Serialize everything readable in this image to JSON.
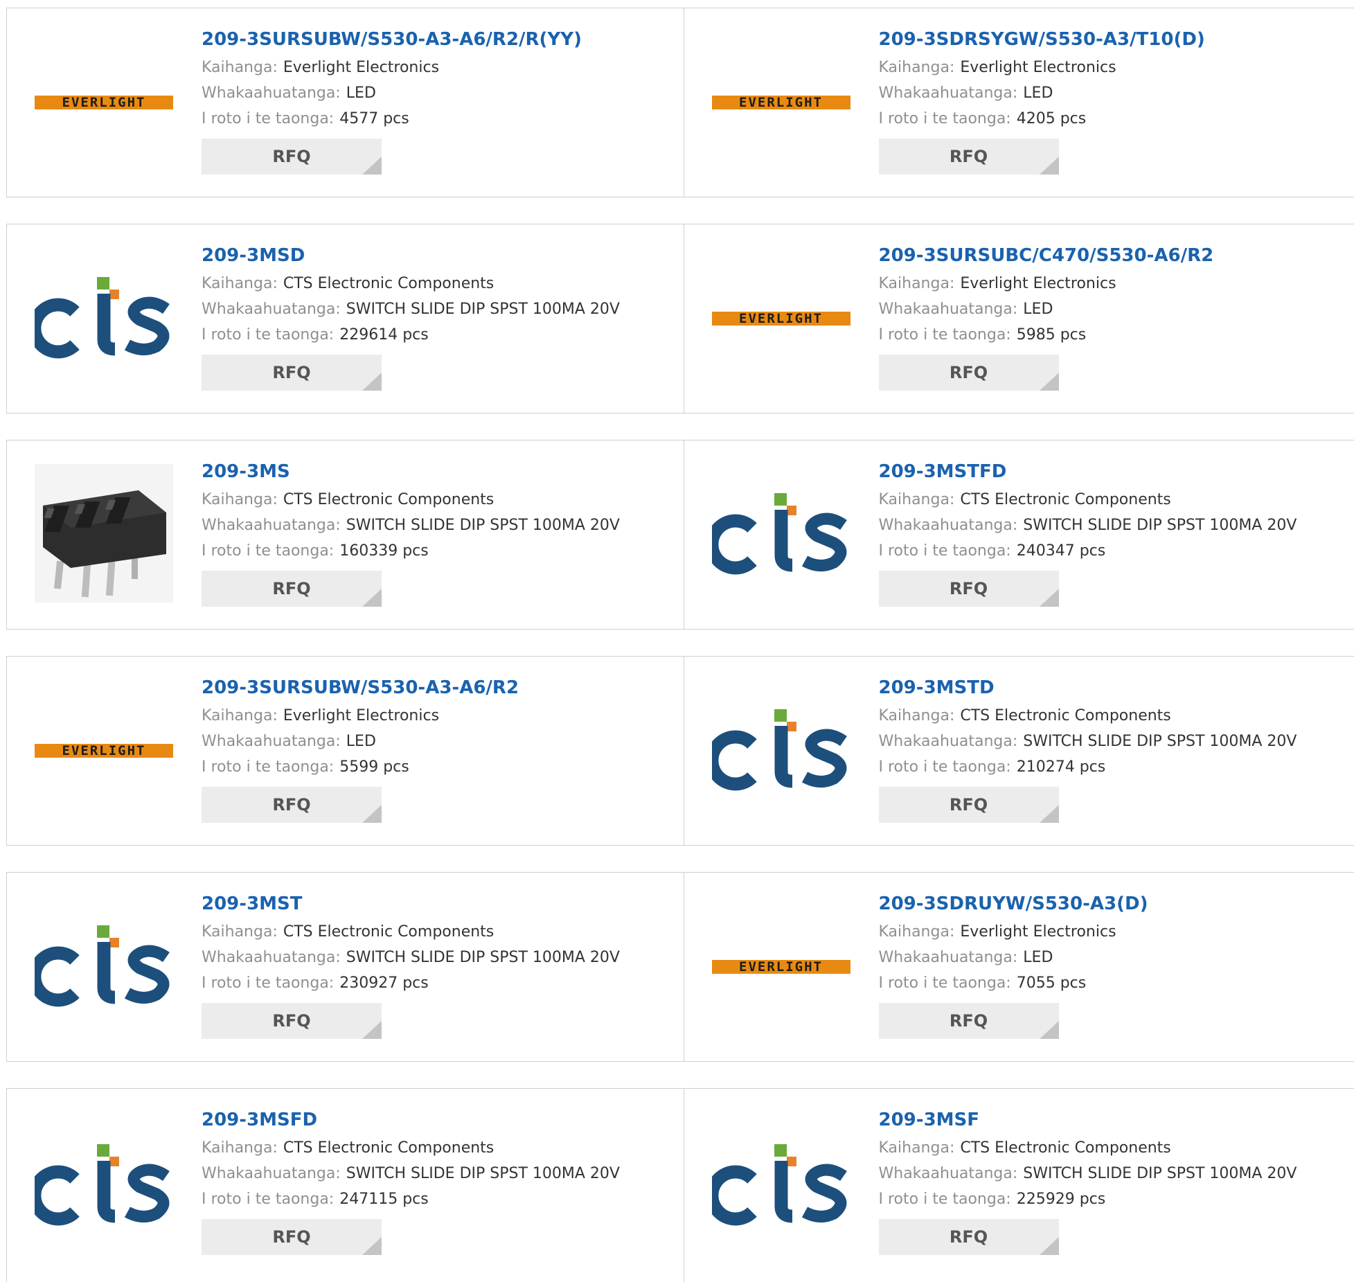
{
  "labels": {
    "manufacturer": "Kaihanga:",
    "description": "Whakaahuatanga:",
    "stock": "I roto i te taonga:",
    "rfq": "RFQ"
  },
  "logos": {
    "everlight": "EVERLIGHT",
    "cts": "cts"
  },
  "colors": {
    "title_link": "#1a62ae",
    "label_gray": "#8f8f8f",
    "cts_blue": "#1d4f7c",
    "cts_green": "#6aaa3a",
    "cts_orange": "#e8822a",
    "everlight_orange": "#e88a12",
    "rfq_bg": "#ececec"
  },
  "products": [
    {
      "part": "209-3SURSUBW/S530-A3-A6/R2/R(YY)",
      "image": "everlight-logo",
      "manufacturer": "Everlight Electronics",
      "description": "LED",
      "stock": "4577 pcs"
    },
    {
      "part": "209-3SDRSYGW/S530-A3/T10(D)",
      "image": "everlight-logo",
      "manufacturer": "Everlight Electronics",
      "description": "LED",
      "stock": "4205 pcs"
    },
    {
      "part": "209-3MSD",
      "image": "cts-logo",
      "manufacturer": "CTS Electronic Components",
      "description": "SWITCH SLIDE DIP SPST 100MA 20V",
      "stock": "229614 pcs"
    },
    {
      "part": "209-3SURSUBC/C470/S530-A6/R2",
      "image": "everlight-logo",
      "manufacturer": "Everlight Electronics",
      "description": "LED",
      "stock": "5985 pcs"
    },
    {
      "part": "209-3MS",
      "image": "dip-switch-photo",
      "manufacturer": "CTS Electronic Components",
      "description": "SWITCH SLIDE DIP SPST 100MA 20V",
      "stock": "160339 pcs"
    },
    {
      "part": "209-3MSTFD",
      "image": "cts-logo",
      "manufacturer": "CTS Electronic Components",
      "description": "SWITCH SLIDE DIP SPST 100MA 20V",
      "stock": "240347 pcs"
    },
    {
      "part": "209-3SURSUBW/S530-A3-A6/R2",
      "image": "everlight-logo",
      "manufacturer": "Everlight Electronics",
      "description": "LED",
      "stock": "5599 pcs"
    },
    {
      "part": "209-3MSTD",
      "image": "cts-logo",
      "manufacturer": "CTS Electronic Components",
      "description": "SWITCH SLIDE DIP SPST 100MA 20V",
      "stock": "210274 pcs"
    },
    {
      "part": "209-3MST",
      "image": "cts-logo",
      "manufacturer": "CTS Electronic Components",
      "description": "SWITCH SLIDE DIP SPST 100MA 20V",
      "stock": "230927 pcs"
    },
    {
      "part": "209-3SDRUYW/S530-A3(D)",
      "image": "everlight-logo",
      "manufacturer": "Everlight Electronics",
      "description": "LED",
      "stock": "7055 pcs"
    },
    {
      "part": "209-3MSFD",
      "image": "cts-logo",
      "manufacturer": "CTS Electronic Components",
      "description": "SWITCH SLIDE DIP SPST 100MA 20V",
      "stock": "247115 pcs"
    },
    {
      "part": "209-3MSF",
      "image": "cts-logo",
      "manufacturer": "CTS Electronic Components",
      "description": "SWITCH SLIDE DIP SPST 100MA 20V",
      "stock": "225929 pcs"
    }
  ]
}
